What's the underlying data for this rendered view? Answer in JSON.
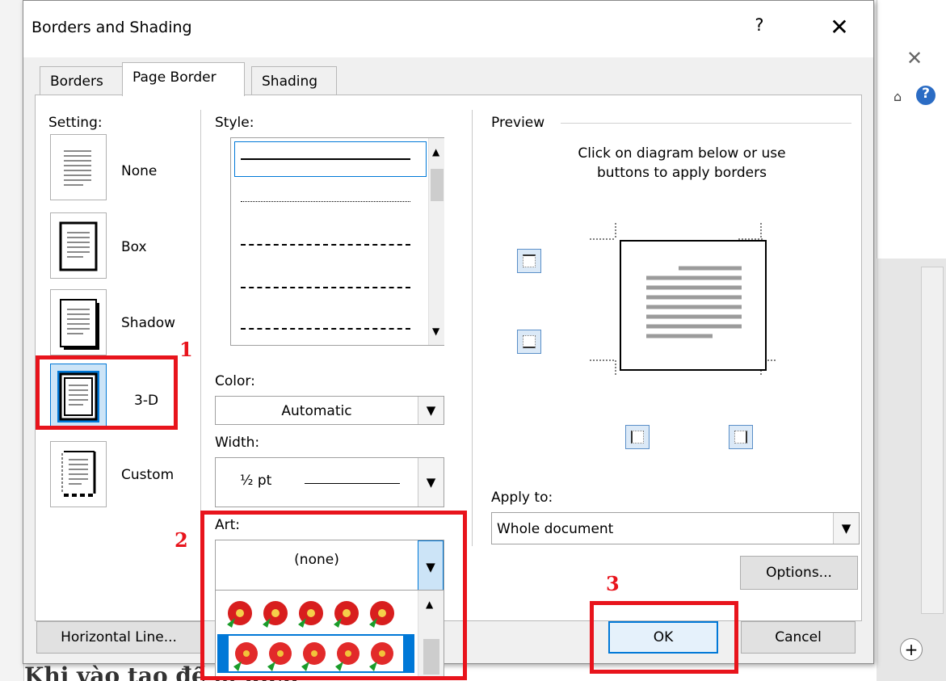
{
  "dialog": {
    "title": "Borders and Shading",
    "help": "?",
    "close": "✕"
  },
  "tabs": [
    {
      "label": "Borders",
      "active": false
    },
    {
      "label": "Page Border",
      "active": true
    },
    {
      "label": "Shading",
      "active": false
    }
  ],
  "setting": {
    "label": "Setting:",
    "items": [
      "None",
      "Box",
      "Shadow",
      "3-D",
      "Custom"
    ],
    "selected": "3-D"
  },
  "style": {
    "label": "Style:"
  },
  "color": {
    "label": "Color:",
    "value": "Automatic"
  },
  "width": {
    "label": "Width:",
    "value": "½ pt"
  },
  "art": {
    "label": "Art:",
    "value": "(none)"
  },
  "preview": {
    "label": "Preview",
    "instruction_line1": "Click on diagram below or use",
    "instruction_line2": "buttons to apply borders"
  },
  "apply_to": {
    "label": "Apply to:",
    "value": "Whole document"
  },
  "buttons": {
    "options": "Options...",
    "ok": "OK",
    "cancel": "Cancel",
    "horizontal_line": "Horizontal Line..."
  },
  "annotations": [
    "1",
    "2",
    "3"
  ],
  "background": {
    "bottom_text": "Khi vào tạo đề … kịch"
  },
  "colors": {
    "annotation": "#e8141c",
    "selection": "#0078d7"
  }
}
